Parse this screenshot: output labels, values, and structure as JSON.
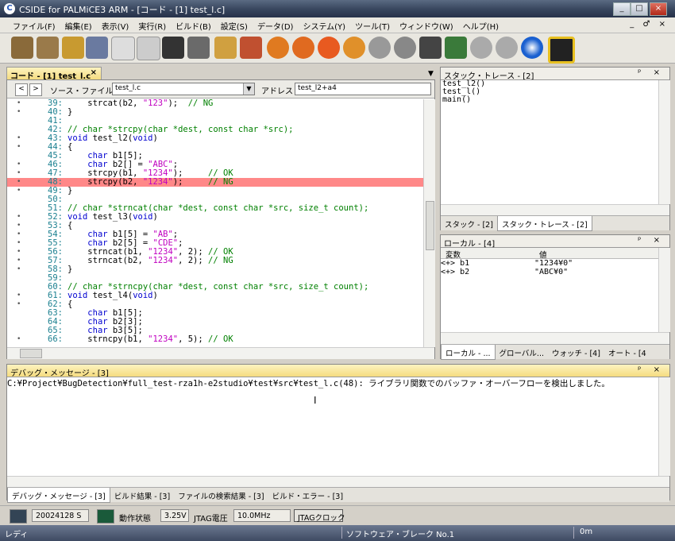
{
  "window": {
    "title": "CSIDE for PALMiCE3 ARM - [コード - [1] test_l.c]"
  },
  "menu": [
    "ファイル(F)",
    "編集(E)",
    "表示(V)",
    "実行(R)",
    "ビルド(B)",
    "設定(S)",
    "データ(D)",
    "システム(Y)",
    "ツール(T)",
    "ウィンドウ(W)",
    "ヘルプ(H)"
  ],
  "mdi_controls": "_ ♂ ×",
  "editor": {
    "tab_label": "コード - [1] test_l.c",
    "close_glyph": "×",
    "source_file_label": "ソース・ファイル",
    "source_file_value": "test_l.c",
    "address_label": "アドレス",
    "address_value": "test_l2+a4",
    "lines": [
      {
        "n": "39:",
        "mark": "•",
        "html": "    strcat(b2, <span class=\"st\">\"123\"</span>);  <span class=\"cm\">// NG</span>"
      },
      {
        "n": "40:",
        "mark": "•",
        "html": "}"
      },
      {
        "n": "41:",
        "mark": "",
        "html": ""
      },
      {
        "n": "42:",
        "mark": "",
        "html": "<span class=\"cm\">// char *strcpy(char *dest, const char *src);</span>"
      },
      {
        "n": "43:",
        "mark": "•",
        "html": "<span class=\"kw\">void</span> test_l2(<span class=\"kw\">void</span>)"
      },
      {
        "n": "44:",
        "mark": "•",
        "html": "{"
      },
      {
        "n": "45:",
        "mark": "",
        "html": "    <span class=\"kw\">char</span> b1[5];"
      },
      {
        "n": "46:",
        "mark": "•",
        "html": "    <span class=\"kw\">char</span> b2[] = <span class=\"st\">\"ABC\"</span>;"
      },
      {
        "n": "47:",
        "mark": "•",
        "html": "    strcpy(b1, <span class=\"st\">\"1234\"</span>);     <span class=\"cm\">// OK</span>"
      },
      {
        "n": "48:",
        "mark": "•",
        "html": "    strcpy(b2, <span class=\"st\">\"1234\"</span>);     <span class=\"cm\">// NG</span>",
        "hl": true
      },
      {
        "n": "49:",
        "mark": "•",
        "html": "}"
      },
      {
        "n": "50:",
        "mark": "",
        "html": ""
      },
      {
        "n": "51:",
        "mark": "",
        "html": "<span class=\"cm\">// char *strncat(char *dest, const char *src, size_t count);</span>"
      },
      {
        "n": "52:",
        "mark": "•",
        "html": "<span class=\"kw\">void</span> test_l3(<span class=\"kw\">void</span>)"
      },
      {
        "n": "53:",
        "mark": "•",
        "html": "{"
      },
      {
        "n": "54:",
        "mark": "•",
        "html": "    <span class=\"kw\">char</span> b1[5] = <span class=\"st\">\"AB\"</span>;"
      },
      {
        "n": "55:",
        "mark": "•",
        "html": "    <span class=\"kw\">char</span> b2[5] = <span class=\"st\">\"CDE\"</span>;"
      },
      {
        "n": "56:",
        "mark": "•",
        "html": "    strncat(b1, <span class=\"st\">\"1234\"</span>, 2); <span class=\"cm\">// OK</span>"
      },
      {
        "n": "57:",
        "mark": "•",
        "html": "    strncat(b2, <span class=\"st\">\"1234\"</span>, 2); <span class=\"cm\">// NG</span>"
      },
      {
        "n": "58:",
        "mark": "•",
        "html": "}"
      },
      {
        "n": "59:",
        "mark": "",
        "html": ""
      },
      {
        "n": "60:",
        "mark": "",
        "html": "<span class=\"cm\">// char *strncpy(char *dest, const char *src, size_t count);</span>"
      },
      {
        "n": "61:",
        "mark": "•",
        "html": "<span class=\"kw\">void</span> test_l4(<span class=\"kw\">void</span>)"
      },
      {
        "n": "62:",
        "mark": "•",
        "html": "{"
      },
      {
        "n": "63:",
        "mark": "",
        "html": "    <span class=\"kw\">char</span> b1[5];"
      },
      {
        "n": "64:",
        "mark": "",
        "html": "    <span class=\"kw\">char</span> b2[3];"
      },
      {
        "n": "65:",
        "mark": "",
        "html": "    <span class=\"kw\">char</span> b3[5];"
      },
      {
        "n": "66:",
        "mark": "•",
        "html": "    strncpy(b1, <span class=\"st\">\"1234\"</span>, 5); <span class=\"cm\">// OK</span>"
      }
    ]
  },
  "stack_panel": {
    "title": "スタック・トレース - [2]",
    "pin": "ᵖ ×",
    "entries": [
      "test_l2()",
      "test_l()",
      "main()"
    ],
    "tabs": [
      "スタック - [2]",
      "スタック・トレース - [2]"
    ]
  },
  "locals_panel": {
    "title": "ローカル - [4]",
    "pin": "ᵖ ×",
    "col_var": "変数",
    "col_val": "値",
    "rows": [
      {
        "name": "<+> b1",
        "value": "\"1234¥0\""
      },
      {
        "name": "<+> b2",
        "value": "\"ABC¥0\""
      }
    ],
    "tabs": [
      "ローカル - ...",
      "グローバル...",
      "ウォッチ - [4]",
      "オート - [4"
    ]
  },
  "debug_panel": {
    "title": "デバッグ・メッセージ - [3]",
    "pin": "ᵖ ×",
    "message": "C:¥Project¥BugDetection¥full_test-rza1h-e2studio¥test¥src¥test_l.c(48): ライブラリ関数でのバッファ・オーバーフローを検出しました。",
    "tabs": [
      "デバッグ・メッセージ - [3]",
      "ビルド結果 - [3]",
      "ファイルの検索結果 - [3]",
      "ビルド・エラー - [3]"
    ]
  },
  "status_row": {
    "date": "20024128 S",
    "state_label": "動作状態",
    "voltage": "3.25V",
    "jtag_voltage_label": "JTAG電圧",
    "clock": "10.0MHz",
    "jtag_clock_button": "JTAGクロック"
  },
  "statusbar": {
    "ready": "レディ",
    "break": "ソフトウェア・ブレーク  No.1",
    "time": "0m"
  },
  "colors": {
    "highlight": "#ff8888",
    "keyword": "#0000d0",
    "comment": "#008000",
    "string": "#c000c0",
    "active_header": "#f5dc80"
  }
}
